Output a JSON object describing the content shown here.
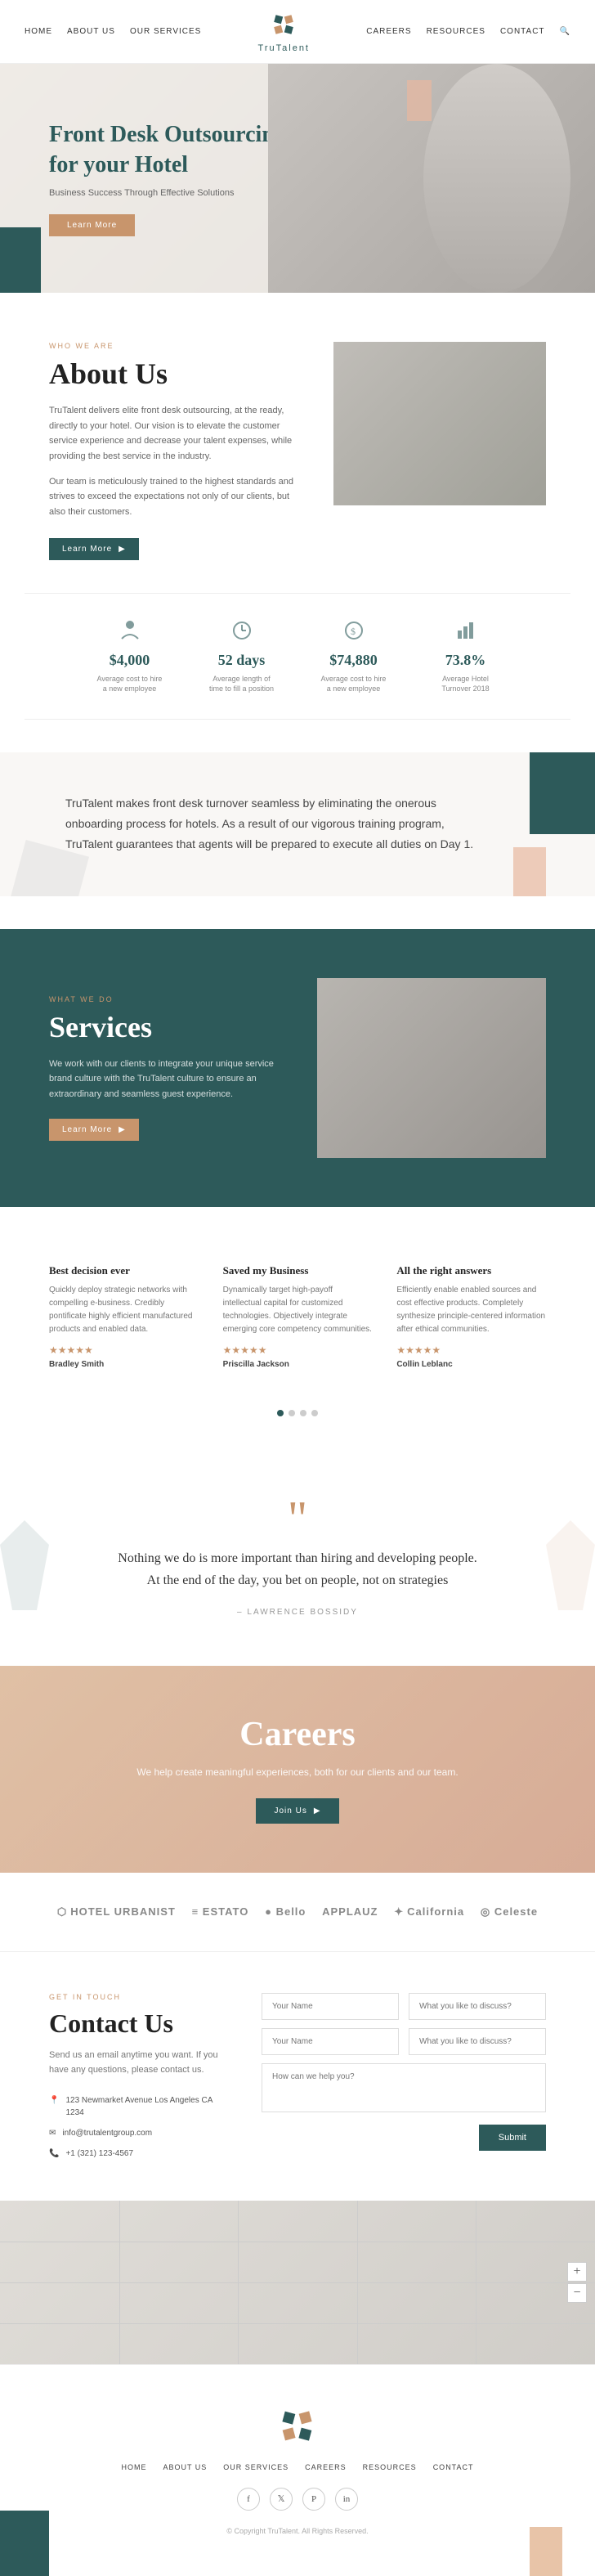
{
  "nav": {
    "links_left": [
      "HOME",
      "ABOUT US",
      "OUR SERVICES"
    ],
    "brand": "TruTalent",
    "links_right": [
      "CAREERS",
      "RESOURCES",
      "CONTACT"
    ]
  },
  "hero": {
    "title": "Front Desk Outsourcing for your Hotel",
    "subtitle": "Business Success Through Effective Solutions",
    "btn_label": "Learn More"
  },
  "about": {
    "tag": "WHO WE ARE",
    "title": "About Us",
    "text1": "TruTalent delivers elite front desk outsourcing, at the ready, directly to your hotel. Our vision is to elevate the customer service experience and decrease your talent expenses, while providing the best service in the industry.",
    "text2": "Our team is meticulously trained to the highest standards and strives to exceed the expectations not only of our clients, but also their customers.",
    "btn_label": "Learn More"
  },
  "stats": [
    {
      "value": "$4,000",
      "label": "Average cost to hire a new employee",
      "icon": "person-icon"
    },
    {
      "value": "52 days",
      "label": "Average length of time to fill a position",
      "icon": "clock-icon"
    },
    {
      "value": "$74,880",
      "label": "Average cost to hire a new employee",
      "icon": "dollar-icon"
    },
    {
      "value": "73.8%",
      "label": "Average Hotel Turnover 2018",
      "icon": "chart-icon"
    }
  ],
  "turnover": {
    "text": "TruTalent makes front desk turnover seamless by eliminating the onerous onboarding process for hotels. As a result of our vigorous training program, TruTalent guarantees that agents will be prepared to execute all duties on Day 1."
  },
  "services": {
    "tag": "WHAT WE DO",
    "title": "Services",
    "text": "We work with our clients to integrate your unique service brand culture with the TruTalent culture to ensure an extraordinary and seamless guest experience.",
    "btn_label": "Learn More"
  },
  "testimonials": [
    {
      "title": "Best decision ever",
      "text": "Quickly deploy strategic networks with compelling e-business. Credibly pontificate highly efficient manufactured products and enabled data.",
      "stars": "★★★★★",
      "name": "Bradley Smith"
    },
    {
      "title": "Saved my Business",
      "text": "Dynamically target high-payoff intellectual capital for customized technologies. Objectively integrate emerging core competency communities.",
      "stars": "★★★★★",
      "name": "Priscilla Jackson"
    },
    {
      "title": "All the right answers",
      "text": "Efficiently enable enabled sources and cost effective products. Completely synthesize principle-centered information after ethical communities.",
      "stars": "★★★★★",
      "name": "Collin Leblanc"
    }
  ],
  "quote": {
    "text": "Nothing we do is more important than hiring and developing people. At the end of the day, you bet on people, not on strategies",
    "author": "– LAWRENCE BOSSIDY"
  },
  "careers": {
    "title": "Careers",
    "text": "We help create meaningful experiences, both for our clients and our team.",
    "btn_label": "Join Us"
  },
  "logos": [
    {
      "name": "HOTEL URBANIST",
      "prefix": "⬡"
    },
    {
      "name": "≡ ESTATO",
      "prefix": ""
    },
    {
      "name": "● Bello",
      "prefix": ""
    },
    {
      "name": "APPLAUZ",
      "prefix": ""
    },
    {
      "name": "California",
      "prefix": "✦"
    },
    {
      "name": "◎ Celeste",
      "prefix": ""
    }
  ],
  "contact": {
    "tag": "GET IN TOUCH",
    "title": "Contact Us",
    "desc": "Send us an email anytime you want. If you have any questions, please contact us.",
    "address": "123 Newmarket Avenue Los Angeles CA 1234",
    "email": "info@trutalentgroup.com",
    "phone": "+1 (321) 123-4567",
    "form": {
      "name_placeholder": "Your Name",
      "last_name_placeholder": "Your Name",
      "discuss_placeholder": "What you like to discuss?",
      "discuss2_placeholder": "What you like to discuss?",
      "help_placeholder": "How can we help you?",
      "submit_label": "Submit"
    }
  },
  "footer": {
    "nav_links": [
      "HOME",
      "ABOUT US",
      "OUR SERVICES",
      "CAREERS",
      "RESOURCES",
      "CONTACT"
    ],
    "copy": "© Copyright TruTalent. All Rights Reserved."
  }
}
